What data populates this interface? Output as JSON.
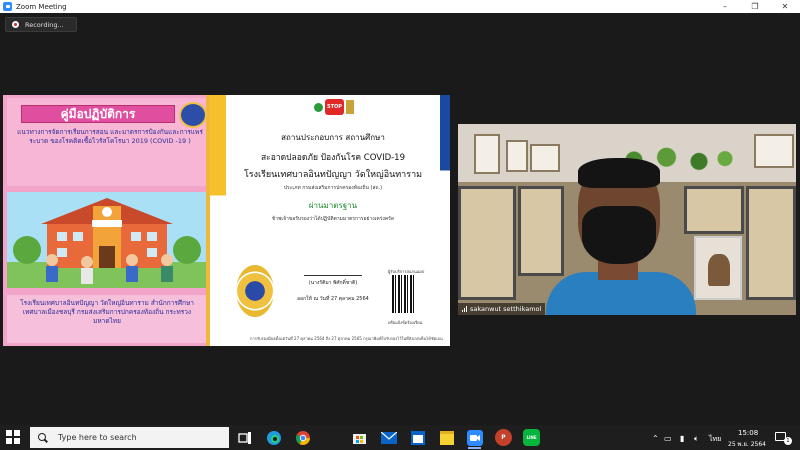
{
  "window": {
    "title": "Zoom Meeting",
    "controls": [
      "–",
      "❐",
      "✕"
    ]
  },
  "recording": {
    "label": "Recording..."
  },
  "shared_screen": {
    "manual": {
      "title": "คู่มือปฏิบัติการ",
      "subtitle": "แนวทางการจัดการเรียนการสอน และมาตรการป้องกันและการแพร่ระบาด ของโรคติดเชื้อไวรัสโคโรนา 2019 (COVID -19 )",
      "school_sign": "SCHOOL",
      "footer": "โรงเรียนเทศบาลอินทปัญญา วัดใหญ่อินทาราม สำนักการศึกษา เทศบาลเมืองชลบุรี กรมส่งเสริมการปกครองท้องถิ่น กระทรวงมหาดไทย"
    },
    "certificate": {
      "logo_text": "STOP",
      "line1": "สถานประกอบการ สถานศึกษา",
      "line2": "สะอาดปลอดภัย ป้องกันโรค COVID-19",
      "line3": "โรงเรียนเทศบาลอินทปัญญา วัดใหญ่อินทาราม",
      "line4": "ประเภท กรมส่งเสริมการปกครองท้องถิ่น (สถ.)",
      "line5": "ผ่านมาตรฐาน",
      "line6": "ข้าพเจ้าขอรับรองว่าได้ปฏิบัติตามมาตรการอย่างเคร่งครัด",
      "signer": "(นางรัติมา พิศักดิ์ชาติ)",
      "date": "ออกให้ ณ วันที่ 27 ตุลาคม 2564",
      "qr_title": "ผู้รับบริการสแกนแอป",
      "qr_caption": "หรือแจ้งข้อร้องเรียน",
      "footer": "การรับรองมีผลตั้งแต่วันที่ 27 ตุลาคม 2564 ถึง 27 ตุลาคม 2565 กรุณาพิมพ์ใบรับรองไว้ในที่สังเกตเห็นได้ชัดเจน"
    }
  },
  "video": {
    "participant_name": "sakanwut setthikamol"
  },
  "taskbar": {
    "search_placeholder": "Type here to search",
    "apps": [
      {
        "name": "task-view"
      },
      {
        "name": "edge"
      },
      {
        "name": "chrome"
      },
      {
        "name": "store"
      },
      {
        "name": "mail"
      },
      {
        "name": "calendar"
      },
      {
        "name": "sticky-notes"
      },
      {
        "name": "zoom",
        "active": true
      },
      {
        "name": "powerpoint",
        "label": "P"
      },
      {
        "name": "line",
        "label": "LINE"
      }
    ],
    "tray": {
      "language": "ไทย",
      "time": "15:08",
      "date": "25 พ.ย. 2564",
      "notifications": "1"
    }
  },
  "colors": {
    "zoom_blue": "#2d8cff",
    "taskbar": "#1e1e1e",
    "meeting_bg": "#1a1a1a",
    "cover_pink": "#f3a5c9",
    "title_magenta": "#e04ea0",
    "shirt_blue": "#2a7fc0"
  }
}
